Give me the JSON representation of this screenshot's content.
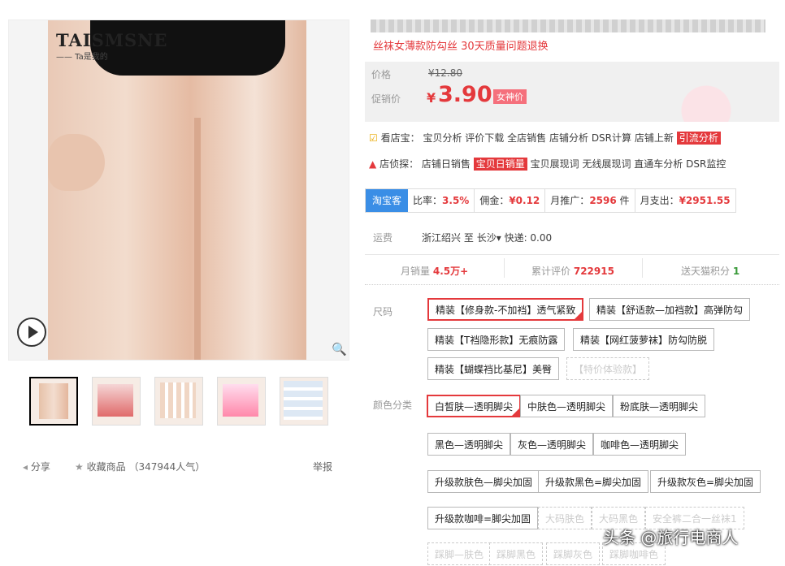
{
  "gallery": {
    "brand": "TAISMSNE",
    "brand_sub": "—— Ta是我的",
    "zoom_icon": "magnifier-icon",
    "play_icon": "play-icon"
  },
  "actions": {
    "share": "分享",
    "favorite": "收藏商品",
    "popularity": "（347944人气）",
    "report": "举报"
  },
  "product": {
    "subtitle": "丝袜女薄款防勾丝 30天质量问题退换",
    "price_label": "价格",
    "original_price": "¥12.80",
    "promo_label": "促销价",
    "currency": "¥",
    "promo_price": "3.90",
    "promo_tag": "女神价"
  },
  "tools": {
    "shop_label": "看店宝：",
    "shop_links": [
      "宝贝分析",
      "评价下载",
      "全店销售",
      "店铺分析",
      "DSR计算",
      "店铺上新"
    ],
    "shop_highlight": "引流分析",
    "detect_label": "店侦探：",
    "detect_link0": "店铺日销售",
    "detect_highlight": "宝贝日销量",
    "detect_links": [
      "宝贝展现词",
      "无线展现词",
      "直通车分析",
      "DSR监控"
    ]
  },
  "stats": {
    "badge": "淘宝客",
    "ratio_label": "比率：",
    "ratio": "3.5%",
    "commission_label": "佣金：",
    "commission": "¥0.12",
    "promo_label": "月推广：",
    "promo": "2596",
    "promo_unit": "件",
    "spend_label": "月支出：",
    "spend": "¥2951.55"
  },
  "shipping": {
    "label": "运费",
    "from": "浙江绍兴",
    "to_word": "至",
    "to": "长沙",
    "express": "快递: 0.00"
  },
  "sales": {
    "monthly_label": "月销量",
    "monthly": "4.5万+",
    "reviews_label": "累计评价",
    "reviews": "722915",
    "points_label": "送天猫积分",
    "points": "1"
  },
  "size": {
    "label": "尺码",
    "options": [
      "精装【修身款-不加裆】透气紧致",
      "精装【舒适款—加裆款】高弹防勾",
      "精装【T裆隐形款】无痕防露",
      "精装【网红菠萝袜】防勾防脱",
      "精装【蝴蝶裆比基尼】美臀",
      "【特价体验款】"
    ]
  },
  "color": {
    "label": "颜色分类",
    "options": [
      "白皙肤—透明脚尖",
      "中肤色—透明脚尖",
      "粉底肤—透明脚尖",
      "黑色—透明脚尖",
      "灰色—透明脚尖",
      "咖啡色—透明脚尖",
      "升级款肤色—脚尖加固",
      "升级款黑色=脚尖加固",
      "升级款灰色=脚尖加固",
      "升级款咖啡=脚尖加固",
      "大码肤色",
      "大码黑色",
      "安全裤二合一丝袜1",
      "踩脚—肤色",
      "踩脚黑色",
      "踩脚灰色",
      "踩脚咖啡色"
    ]
  },
  "watermark": "头条 @旅行电商人"
}
